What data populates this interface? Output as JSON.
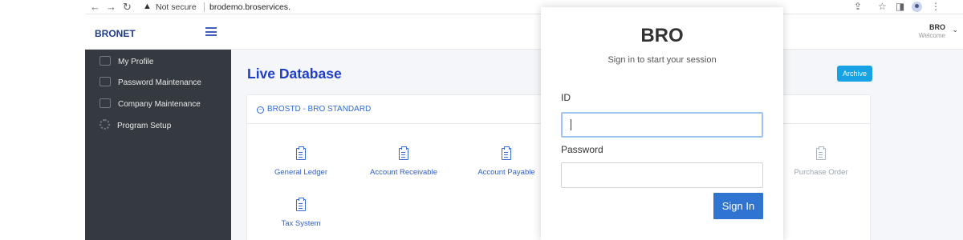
{
  "browser": {
    "not_secure": "Not secure",
    "url": "brodemo.broservices."
  },
  "app": {
    "brand": "BRONET",
    "user_name": "BRO",
    "user_sub": "Welcome"
  },
  "sidebar": {
    "items": [
      {
        "label": "My Profile",
        "icon": "profile-icon"
      },
      {
        "label": "Password Maintenance",
        "icon": "users-icon"
      },
      {
        "label": "Company Maintenance",
        "icon": "building-icon"
      },
      {
        "label": "Program Setup",
        "icon": "gear-icon"
      }
    ]
  },
  "main": {
    "title": "Live Database",
    "archive_label": "Archive",
    "card_title": "BROSTD - BRO STANDARD",
    "modules": [
      {
        "label": "General Ledger"
      },
      {
        "label": "Account Receivable"
      },
      {
        "label": "Account Payable"
      },
      {
        "label": "Purchase Order"
      },
      {
        "label": "Tax System"
      }
    ]
  },
  "login": {
    "title": "BRO",
    "subtitle": "Sign in to start your session",
    "id_label": "ID",
    "id_value": "",
    "password_label": "Password",
    "password_value": "",
    "submit_label": "Sign In"
  },
  "colors": {
    "brand": "#1f3c88",
    "sidebar_bg": "#343a40",
    "accent": "#2f74d0",
    "archive": "#17a2e6",
    "heading": "#1f3ec8"
  }
}
